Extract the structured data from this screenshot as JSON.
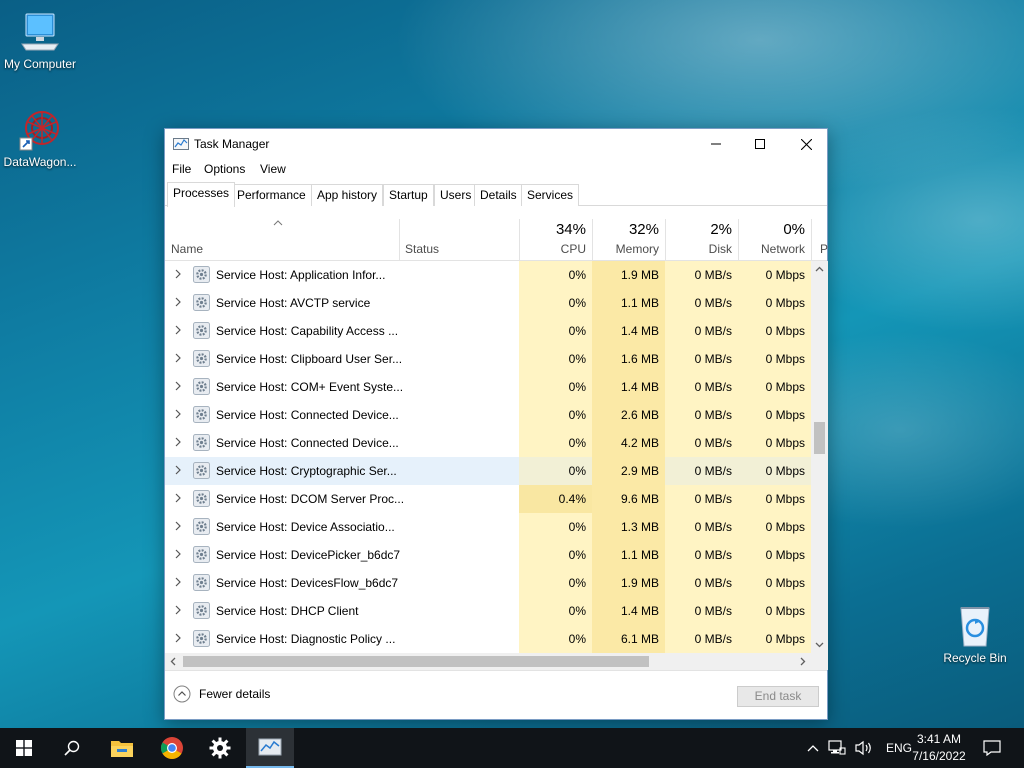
{
  "desktop": {
    "icons": [
      {
        "label": "My Computer"
      },
      {
        "label": "DataWagon..."
      },
      {
        "label": "Recycle Bin"
      }
    ]
  },
  "window": {
    "title": "Task Manager",
    "menu": [
      "File",
      "Options",
      "View"
    ],
    "tabs": [
      "Processes",
      "Performance",
      "App history",
      "Startup",
      "Users",
      "Details",
      "Services"
    ],
    "active_tab": "Processes"
  },
  "columns": {
    "name": "Name",
    "status": "Status",
    "cpu": {
      "pct": "34%",
      "label": "CPU"
    },
    "memory": {
      "pct": "32%",
      "label": "Memory"
    },
    "disk": {
      "pct": "2%",
      "label": "Disk"
    },
    "network": {
      "pct": "0%",
      "label": "Network"
    },
    "power_partial": "P"
  },
  "rows": [
    {
      "name": "Service Host: Application Infor...",
      "cpu": "0%",
      "mem": "1.9 MB",
      "disk": "0 MB/s",
      "net": "0 Mbps"
    },
    {
      "name": "Service Host: AVCTP service",
      "cpu": "0%",
      "mem": "1.1 MB",
      "disk": "0 MB/s",
      "net": "0 Mbps"
    },
    {
      "name": "Service Host: Capability Access ...",
      "cpu": "0%",
      "mem": "1.4 MB",
      "disk": "0 MB/s",
      "net": "0 Mbps"
    },
    {
      "name": "Service Host: Clipboard User Ser...",
      "cpu": "0%",
      "mem": "1.6 MB",
      "disk": "0 MB/s",
      "net": "0 Mbps"
    },
    {
      "name": "Service Host: COM+ Event Syste...",
      "cpu": "0%",
      "mem": "1.4 MB",
      "disk": "0 MB/s",
      "net": "0 Mbps"
    },
    {
      "name": "Service Host: Connected Device...",
      "cpu": "0%",
      "mem": "2.6 MB",
      "disk": "0 MB/s",
      "net": "0 Mbps"
    },
    {
      "name": "Service Host: Connected Device...",
      "cpu": "0%",
      "mem": "4.2 MB",
      "disk": "0 MB/s",
      "net": "0 Mbps"
    },
    {
      "name": "Service Host: Cryptographic Ser...",
      "cpu": "0%",
      "mem": "2.9 MB",
      "disk": "0 MB/s",
      "net": "0 Mbps",
      "selected": true
    },
    {
      "name": "Service Host: DCOM Server Proc...",
      "cpu": "0.4%",
      "mem": "9.6 MB",
      "disk": "0 MB/s",
      "net": "0 Mbps"
    },
    {
      "name": "Service Host: Device Associatio...",
      "cpu": "0%",
      "mem": "1.3 MB",
      "disk": "0 MB/s",
      "net": "0 Mbps"
    },
    {
      "name": "Service Host: DevicePicker_b6dc7",
      "cpu": "0%",
      "mem": "1.1 MB",
      "disk": "0 MB/s",
      "net": "0 Mbps"
    },
    {
      "name": "Service Host: DevicesFlow_b6dc7",
      "cpu": "0%",
      "mem": "1.9 MB",
      "disk": "0 MB/s",
      "net": "0 Mbps"
    },
    {
      "name": "Service Host: DHCP Client",
      "cpu": "0%",
      "mem": "1.4 MB",
      "disk": "0 MB/s",
      "net": "0 Mbps"
    },
    {
      "name": "Service Host: Diagnostic Policy ...",
      "cpu": "0%",
      "mem": "6.1 MB",
      "disk": "0 MB/s",
      "net": "0 Mbps"
    }
  ],
  "footer": {
    "fewer_details": "Fewer details",
    "end_task": "End task"
  },
  "taskbar": {
    "language": "ENG",
    "time": "3:41 AM",
    "date": "7/16/2022"
  }
}
